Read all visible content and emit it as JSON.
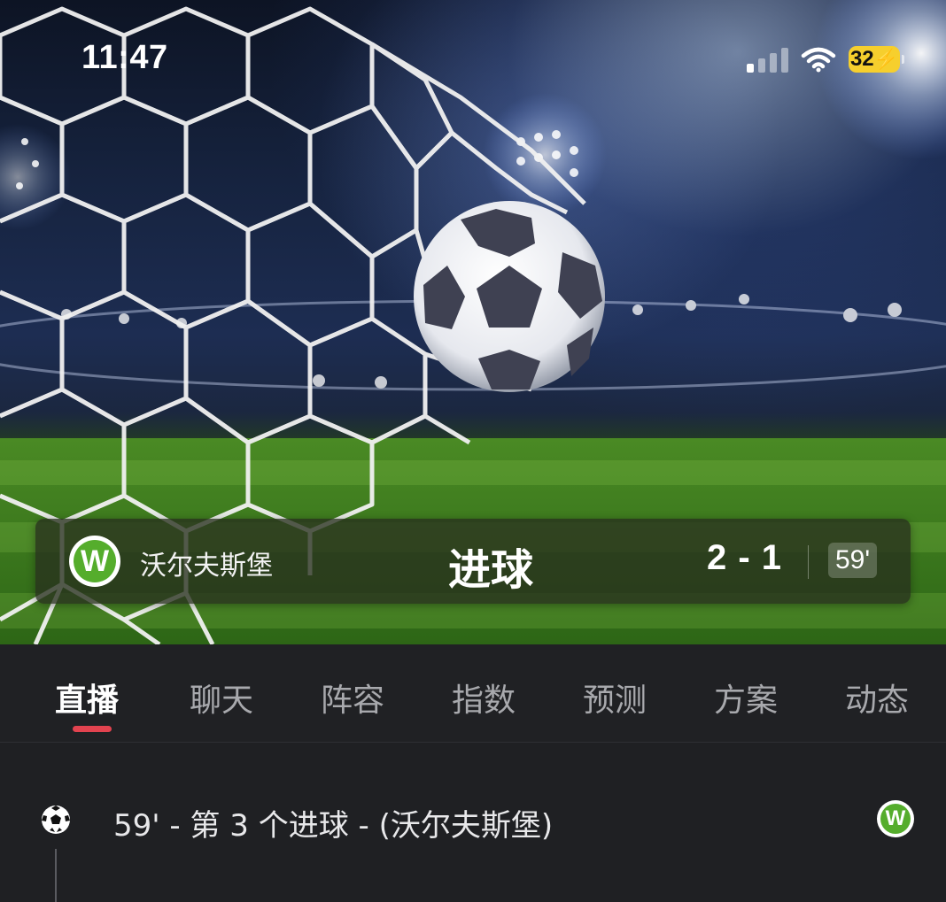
{
  "status_bar": {
    "time": "11:47",
    "battery": "32",
    "signal_icon": "cellular-signal-icon",
    "wifi_icon": "wifi-icon",
    "battery_icon": "battery-charging-icon"
  },
  "goal_banner": {
    "team_name": "沃尔夫斯堡",
    "team_logo_letter": "W",
    "event_label": "进球",
    "score": "2 - 1",
    "minute": "59'"
  },
  "tabs": [
    {
      "label": "直播",
      "active": true
    },
    {
      "label": "聊天",
      "active": false
    },
    {
      "label": "阵容",
      "active": false
    },
    {
      "label": "指数",
      "active": false
    },
    {
      "label": "预测",
      "active": false
    },
    {
      "label": "方案",
      "active": false
    },
    {
      "label": "动态",
      "active": false
    }
  ],
  "feed": [
    {
      "icon": "soccer-ball-icon",
      "text": "59' - 第 3 个进球 - (沃尔夫斯堡)",
      "team_logo_letter": "W"
    }
  ],
  "colors": {
    "tab_indicator": "#e2434f",
    "team_green": "#55ad2c",
    "battery_yellow": "#f6cf2d",
    "background": "#1f2023"
  }
}
